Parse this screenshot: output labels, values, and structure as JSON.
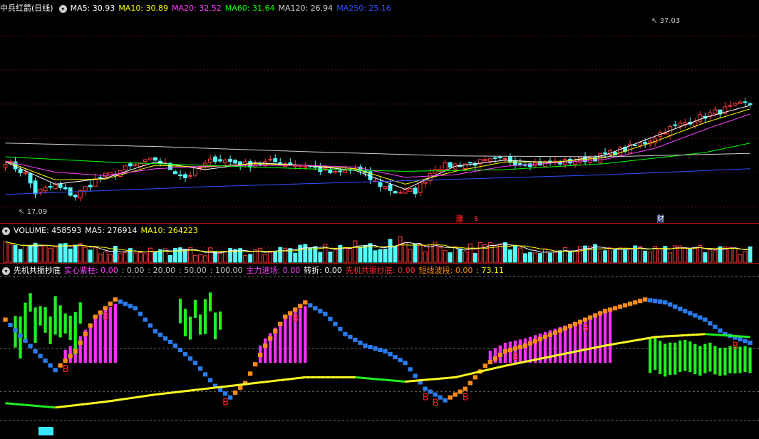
{
  "main_panel": {
    "title": "中兵红箭(日线)",
    "ma_labels": [
      {
        "text": "MA5: 30.93",
        "color": "#ffffff"
      },
      {
        "text": "MA10: 30.89",
        "color": "#ffff00"
      },
      {
        "text": "MA20: 32.52",
        "color": "#ff40ff"
      },
      {
        "text": "MA60: 31.64",
        "color": "#00ff00"
      },
      {
        "text": "MA120: 26.94",
        "color": "#d0d0d0"
      },
      {
        "text": "MA250: 25.16",
        "color": "#3050ff"
      }
    ],
    "high_label": "37.03",
    "low_label": "17.09",
    "events": [
      {
        "text": "涨",
        "color": "#ff3030",
        "bg": "#4a0000"
      },
      {
        "text": "$",
        "color": "#ff3030",
        "bg": ""
      },
      {
        "text": "财",
        "color": "#ffffff",
        "bg": "#203070"
      }
    ]
  },
  "volume_panel": {
    "labels": [
      {
        "text": "VOLUME: 458593",
        "color": "#ffffff"
      },
      {
        "text": "MA5: 276914",
        "color": "#ffffff"
      },
      {
        "text": "MA10: 264223",
        "color": "#ffff00"
      }
    ]
  },
  "indicator_panel": {
    "labels": [
      {
        "text": "先机共振抄底",
        "color": "#ffffff"
      },
      {
        "text": "实心紫柱: 0.00",
        "color": "#ff40ff"
      },
      {
        "text": ": 0.00",
        "color": "#c0c0c0"
      },
      {
        "text": ": 20.00",
        "color": "#c0c0c0"
      },
      {
        "text": ": 50.00",
        "color": "#c0c0c0"
      },
      {
        "text": ": 100.00",
        "color": "#c0c0c0"
      },
      {
        "text": "主力进场: 0.00",
        "color": "#ff40ff"
      },
      {
        "text": "转折: 0.00",
        "color": "#ffffff"
      },
      {
        "text": "先机共振抄底: 0.00",
        "color": "#ff3030"
      },
      {
        "text": "短线波段: 0.00",
        "color": "#ff8c00"
      },
      {
        "text": ": 73.11",
        "color": "#ffff00"
      }
    ],
    "buy_marker": "B"
  },
  "chart_data": {
    "type": "candlestick",
    "bars": 150,
    "price_range": [
      15.5,
      39.5
    ],
    "high": 37.03,
    "low": 17.09,
    "ma_last": {
      "MA5": 30.93,
      "MA10": 30.89,
      "MA20": 32.52,
      "MA60": 31.64,
      "MA120": 26.94,
      "MA250": 25.16
    },
    "volume_last": 458593,
    "volume_ma5_last": 276914,
    "volume_ma10_last": 264223,
    "indicator_range": [
      0,
      100
    ],
    "indicator_levels": [
      0,
      20,
      50,
      100
    ],
    "indicator_last": 73.11,
    "price_close_anchors": [
      [
        0,
        22.5
      ],
      [
        4,
        21.0
      ],
      [
        6,
        18.8
      ],
      [
        10,
        19.6
      ],
      [
        14,
        18.4
      ],
      [
        18,
        20.3
      ],
      [
        24,
        21.6
      ],
      [
        30,
        22.7
      ],
      [
        36,
        20.6
      ],
      [
        42,
        22.8
      ],
      [
        48,
        22.1
      ],
      [
        54,
        22.4
      ],
      [
        60,
        22.0
      ],
      [
        66,
        21.0
      ],
      [
        70,
        21.6
      ],
      [
        74,
        20.0
      ],
      [
        78,
        18.9
      ],
      [
        82,
        19.0
      ],
      [
        86,
        21.8
      ],
      [
        92,
        22.2
      ],
      [
        100,
        22.6
      ],
      [
        106,
        22.2
      ],
      [
        112,
        22.4
      ],
      [
        118,
        22.9
      ],
      [
        124,
        23.9
      ],
      [
        128,
        24.7
      ],
      [
        132,
        26.1
      ],
      [
        136,
        27.0
      ],
      [
        142,
        28.2
      ],
      [
        148,
        29.2
      ]
    ],
    "price_series_anchors": {
      "MA5": [
        [
          0,
          22.4
        ],
        [
          10,
          19.8
        ],
        [
          20,
          20.5
        ],
        [
          30,
          22.4
        ],
        [
          40,
          21.5
        ],
        [
          50,
          22.3
        ],
        [
          60,
          22.0
        ],
        [
          70,
          21.4
        ],
        [
          80,
          19.2
        ],
        [
          90,
          21.9
        ],
        [
          100,
          22.6
        ],
        [
          110,
          22.3
        ],
        [
          120,
          23.2
        ],
        [
          130,
          25.4
        ],
        [
          140,
          27.6
        ],
        [
          149,
          29.0
        ]
      ],
      "MA10": [
        [
          0,
          22.5
        ],
        [
          10,
          20.3
        ],
        [
          20,
          20.4
        ],
        [
          30,
          22.0
        ],
        [
          40,
          21.8
        ],
        [
          50,
          22.2
        ],
        [
          60,
          22.0
        ],
        [
          70,
          21.6
        ],
        [
          80,
          19.8
        ],
        [
          90,
          21.3
        ],
        [
          100,
          22.4
        ],
        [
          110,
          22.4
        ],
        [
          120,
          22.9
        ],
        [
          130,
          24.8
        ],
        [
          140,
          27.0
        ],
        [
          149,
          28.6
        ]
      ],
      "MA20": [
        [
          0,
          22.5
        ],
        [
          10,
          21.2
        ],
        [
          20,
          20.8
        ],
        [
          30,
          21.6
        ],
        [
          40,
          21.9
        ],
        [
          50,
          22.0
        ],
        [
          60,
          22.0
        ],
        [
          70,
          21.8
        ],
        [
          80,
          20.6
        ],
        [
          90,
          20.9
        ],
        [
          100,
          21.9
        ],
        [
          110,
          22.3
        ],
        [
          120,
          22.7
        ],
        [
          130,
          24.0
        ],
        [
          140,
          26.2
        ],
        [
          149,
          28.0
        ]
      ],
      "MA60": [
        [
          0,
          23.0
        ],
        [
          20,
          22.4
        ],
        [
          40,
          22.0
        ],
        [
          60,
          21.6
        ],
        [
          80,
          21.3
        ],
        [
          100,
          21.5
        ],
        [
          120,
          22.2
        ],
        [
          140,
          23.5
        ],
        [
          149,
          24.6
        ]
      ],
      "MA120": [
        [
          0,
          24.6
        ],
        [
          30,
          24.2
        ],
        [
          60,
          23.6
        ],
        [
          90,
          23.1
        ],
        [
          120,
          23.0
        ],
        [
          149,
          23.4
        ]
      ],
      "MA250": [
        [
          0,
          18.6
        ],
        [
          40,
          19.5
        ],
        [
          80,
          20.2
        ],
        [
          120,
          20.9
        ],
        [
          149,
          21.6
        ]
      ]
    },
    "volume_anchors": [
      [
        0,
        0.85
      ],
      [
        10,
        0.55
      ],
      [
        20,
        0.5
      ],
      [
        30,
        0.45
      ],
      [
        40,
        0.4
      ],
      [
        50,
        0.45
      ],
      [
        60,
        0.5
      ],
      [
        70,
        0.6
      ],
      [
        80,
        0.75
      ],
      [
        90,
        0.55
      ],
      [
        100,
        0.6
      ],
      [
        110,
        0.5
      ],
      [
        120,
        0.55
      ],
      [
        130,
        0.45
      ],
      [
        140,
        0.5
      ],
      [
        149,
        0.5
      ]
    ],
    "osc_anchors": [
      [
        0,
        70
      ],
      [
        6,
        48
      ],
      [
        10,
        35
      ],
      [
        14,
        48
      ],
      [
        18,
        72
      ],
      [
        22,
        84
      ],
      [
        26,
        78
      ],
      [
        30,
        62
      ],
      [
        34,
        52
      ],
      [
        38,
        40
      ],
      [
        42,
        24
      ],
      [
        45,
        16
      ],
      [
        48,
        26
      ],
      [
        52,
        52
      ],
      [
        56,
        72
      ],
      [
        60,
        82
      ],
      [
        64,
        74
      ],
      [
        68,
        60
      ],
      [
        72,
        52
      ],
      [
        76,
        48
      ],
      [
        80,
        40
      ],
      [
        84,
        22
      ],
      [
        88,
        14
      ],
      [
        92,
        22
      ],
      [
        96,
        38
      ],
      [
        100,
        48
      ],
      [
        104,
        52
      ],
      [
        108,
        58
      ],
      [
        112,
        64
      ],
      [
        116,
        70
      ],
      [
        120,
        76
      ],
      [
        124,
        80
      ],
      [
        128,
        84
      ],
      [
        132,
        82
      ],
      [
        136,
        76
      ],
      [
        140,
        70
      ],
      [
        144,
        60
      ],
      [
        149,
        54
      ]
    ],
    "slow_line_anchors": [
      [
        0,
        12
      ],
      [
        10,
        9
      ],
      [
        20,
        13
      ],
      [
        30,
        18
      ],
      [
        40,
        22
      ],
      [
        50,
        26
      ],
      [
        60,
        30
      ],
      [
        70,
        30
      ],
      [
        80,
        27
      ],
      [
        90,
        30
      ],
      [
        100,
        38
      ],
      [
        110,
        45
      ],
      [
        120,
        52
      ],
      [
        130,
        58
      ],
      [
        140,
        60
      ],
      [
        149,
        58
      ]
    ]
  }
}
